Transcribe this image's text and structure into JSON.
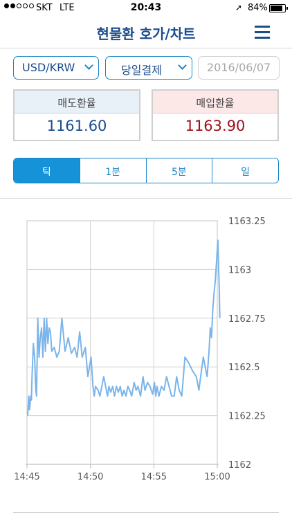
{
  "status_bar": {
    "carrier": "SKT",
    "network": "LTE",
    "time": "20:43",
    "battery": "84%",
    "battery_level": 0.84,
    "signal_bars": 2,
    "signal_total": 5,
    "location_icon": "location-arrow-icon"
  },
  "header": {
    "title": "현물환 호가/차트",
    "menu_icon": "hamburger-menu-icon"
  },
  "controls": {
    "currency": "USD/KRW",
    "settlement": "당일결제",
    "date_placeholder": "2016/06/07",
    "accent_color": "#1b86c8"
  },
  "rates": {
    "sell_label": "매도환율",
    "sell_value": "1161.60",
    "buy_label": "매입환율",
    "buy_value": "1163.90",
    "sell_color": "#1b4c8c",
    "buy_color": "#a0101a"
  },
  "tabs": [
    {
      "label": "틱",
      "active": true
    },
    {
      "label": "1분",
      "active": false
    },
    {
      "label": "5분",
      "active": false
    },
    {
      "label": "일",
      "active": false
    }
  ],
  "chart_data": {
    "type": "line",
    "title": "",
    "xlabel": "",
    "ylabel": "",
    "line_color": "#7ab4ea",
    "x_ticks": [
      "14:45",
      "14:50",
      "14:55",
      "15:00"
    ],
    "x_tick_minutes": [
      45,
      50,
      55,
      60
    ],
    "xlim": [
      45,
      60
    ],
    "y_ticks": [
      "1162",
      "1162.25",
      "1162.5",
      "1162.75",
      "1163",
      "1163.25"
    ],
    "ylim": [
      1162,
      1163.25
    ],
    "grid": true,
    "x": [
      45.05,
      45.15,
      45.2,
      45.3,
      45.35,
      45.4,
      45.5,
      45.6,
      45.7,
      45.75,
      45.85,
      45.95,
      46.05,
      46.15,
      46.25,
      46.35,
      46.45,
      46.55,
      46.65,
      46.75,
      46.85,
      46.95,
      47.15,
      47.35,
      47.55,
      47.75,
      48.0,
      48.25,
      48.5,
      48.75,
      48.95,
      49.15,
      49.35,
      49.6,
      49.8,
      50.05,
      50.2,
      50.3,
      50.4,
      50.6,
      50.75,
      51.05,
      51.35,
      51.45,
      51.6,
      51.75,
      51.9,
      52.05,
      52.2,
      52.35,
      52.5,
      52.65,
      52.8,
      52.95,
      53.1,
      53.25,
      53.45,
      53.6,
      53.75,
      53.95,
      54.15,
      54.3,
      54.5,
      54.7,
      54.9,
      55.05,
      55.15,
      55.25,
      55.4,
      55.6,
      55.8,
      56.0,
      56.2,
      56.4,
      56.6,
      56.8,
      57.0,
      57.2,
      57.45,
      57.75,
      58.05,
      58.35,
      58.55,
      58.75,
      58.9,
      59.05,
      59.2,
      59.35,
      59.45,
      59.55,
      59.65,
      59.75,
      59.85,
      59.95,
      60.05,
      60.15,
      60.2
    ],
    "y": [
      1162.25,
      1162.35,
      1162.28,
      1162.35,
      1162.33,
      1162.45,
      1162.62,
      1162.55,
      1162.38,
      1162.35,
      1162.75,
      1162.55,
      1162.65,
      1162.7,
      1162.55,
      1162.75,
      1162.58,
      1162.75,
      1162.62,
      1162.7,
      1162.68,
      1162.58,
      1162.6,
      1162.55,
      1162.58,
      1162.75,
      1162.58,
      1162.65,
      1162.57,
      1162.6,
      1162.55,
      1162.68,
      1162.55,
      1162.6,
      1162.45,
      1162.55,
      1162.4,
      1162.35,
      1162.4,
      1162.38,
      1162.35,
      1162.45,
      1162.35,
      1162.4,
      1162.37,
      1162.4,
      1162.35,
      1162.4,
      1162.37,
      1162.4,
      1162.35,
      1162.38,
      1162.35,
      1162.4,
      1162.38,
      1162.35,
      1162.42,
      1162.38,
      1162.4,
      1162.35,
      1162.45,
      1162.38,
      1162.42,
      1162.4,
      1162.36,
      1162.42,
      1162.35,
      1162.4,
      1162.35,
      1162.4,
      1162.38,
      1162.45,
      1162.4,
      1162.35,
      1162.35,
      1162.45,
      1162.38,
      1162.35,
      1162.55,
      1162.52,
      1162.48,
      1162.45,
      1162.38,
      1162.48,
      1162.55,
      1162.5,
      1162.45,
      1162.58,
      1162.7,
      1162.65,
      1162.8,
      1162.88,
      1162.95,
      1163.05,
      1163.15,
      1162.9,
      1162.75
    ]
  }
}
